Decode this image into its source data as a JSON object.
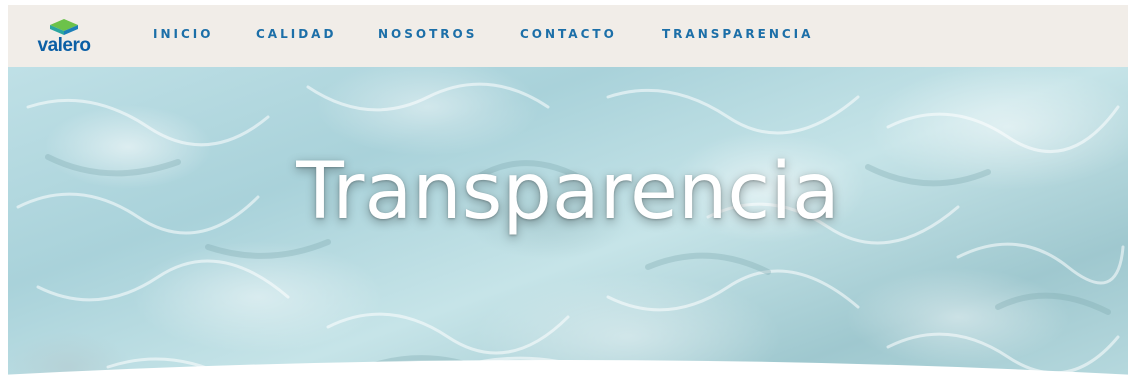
{
  "brand": {
    "name": "valero",
    "colors": {
      "blue": "#0b5fa5",
      "teal": "#2ba6a0",
      "green": "#6cc24a"
    }
  },
  "nav": {
    "items": [
      {
        "label": "INICIO"
      },
      {
        "label": "CALIDAD"
      },
      {
        "label": "NOSOTROS"
      },
      {
        "label": "CONTACTO"
      },
      {
        "label": "TRANSPARENCIA"
      }
    ],
    "background": "#f1ede8",
    "link_color": "#1c6fa8"
  },
  "hero": {
    "title": "Transparencia"
  }
}
